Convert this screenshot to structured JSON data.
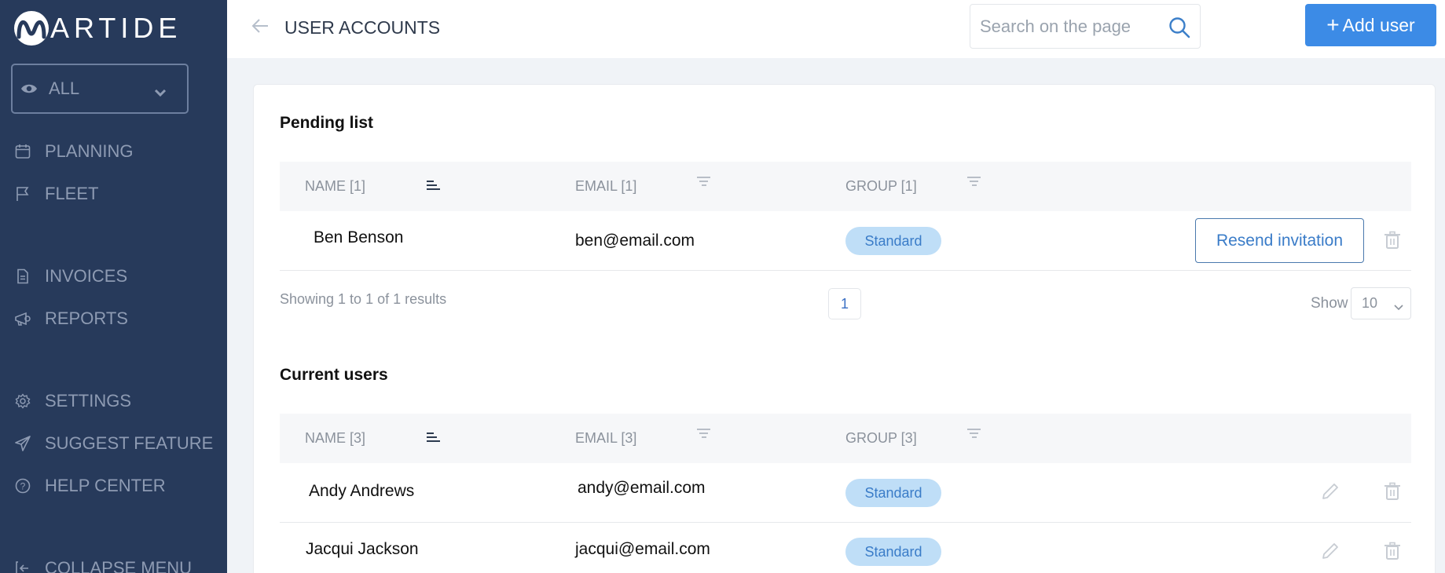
{
  "app": {
    "logo_text": "ARTIDE",
    "logo_initial": "M"
  },
  "sidebar": {
    "view_filter": {
      "value": "ALL",
      "icon": "eye-icon"
    },
    "items": [
      {
        "label": "PLANNING",
        "icon": "calendar-icon"
      },
      {
        "label": "FLEET",
        "icon": "flag-icon"
      },
      {
        "label": "INVOICES",
        "icon": "document-icon"
      },
      {
        "label": "REPORTS",
        "icon": "megaphone-icon"
      },
      {
        "label": "SETTINGS",
        "icon": "gear-icon"
      },
      {
        "label": "SUGGEST FEATURE",
        "icon": "send-icon"
      },
      {
        "label": "HELP CENTER",
        "icon": "help-icon"
      },
      {
        "label": "COLLAPSE MENU",
        "icon": "collapse-icon"
      }
    ]
  },
  "header": {
    "title": "USER ACCOUNTS",
    "search_placeholder": "Search on the page",
    "search_value": "",
    "add_user_label": "Add user"
  },
  "pending": {
    "title": "Pending list",
    "columns": [
      "NAME [1]",
      "EMAIL [1]",
      "GROUP [1]"
    ],
    "rows": [
      {
        "name": "Ben Benson",
        "email": "ben@email.com",
        "group": "Standard",
        "action": "Resend invitation"
      }
    ],
    "showing_text": "Showing 1 to 1 of 1 results",
    "current_page": "1",
    "show_label": "Show",
    "page_size": "10"
  },
  "current": {
    "title": "Current users",
    "columns": [
      "NAME [3]",
      "EMAIL [3]",
      "GROUP [3]"
    ],
    "rows": [
      {
        "name": "Andy Andrews",
        "email": "andy@email.com",
        "group": "Standard"
      },
      {
        "name": "Jacqui Jackson",
        "email": "jacqui@email.com",
        "group": "Standard"
      }
    ]
  },
  "colors": {
    "sidebar_bg": "#273a5b",
    "accent": "#3c8be6",
    "badge_bg": "#bfdef7",
    "badge_text": "#3a7cc8"
  }
}
